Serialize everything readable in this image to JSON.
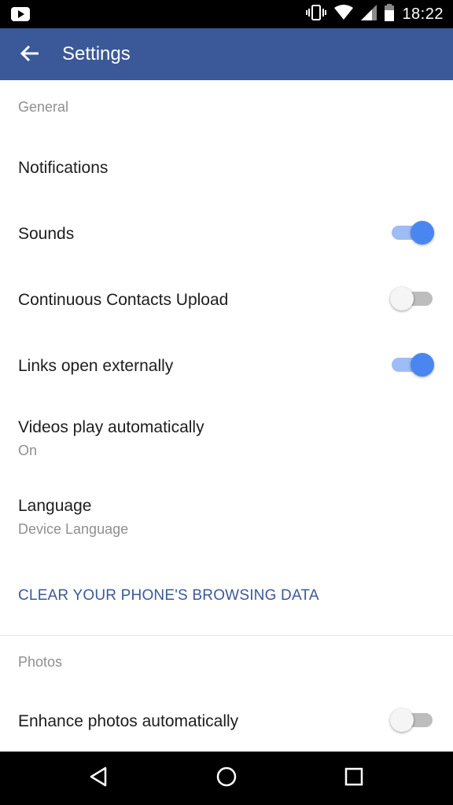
{
  "status_bar": {
    "time": "18:22",
    "left_icon": "youtube-notification-icon",
    "icons": [
      "vibrate-icon",
      "wifi-icon",
      "cell-signal-icon",
      "battery-icon"
    ]
  },
  "app_bar": {
    "title": "Settings",
    "back_icon": "back-arrow-icon",
    "color": "#3b5998"
  },
  "sections": {
    "general": {
      "header": "General",
      "notifications": {
        "title": "Notifications"
      },
      "sounds": {
        "title": "Sounds",
        "enabled": true
      },
      "contacts_upload": {
        "title": "Continuous Contacts Upload",
        "enabled": false
      },
      "links_external": {
        "title": "Links open externally",
        "enabled": true
      },
      "videos_autoplay": {
        "title": "Videos play automatically",
        "value": "On"
      },
      "language": {
        "title": "Language",
        "value": "Device Language"
      },
      "clear_data": {
        "label": "CLEAR YOUR PHONE'S BROWSING DATA"
      }
    },
    "photos": {
      "header": "Photos",
      "enhance": {
        "title": "Enhance photos automatically",
        "enabled": false
      }
    }
  },
  "nav_bar": {
    "icons": [
      "nav-back-icon",
      "nav-home-icon",
      "nav-recents-icon"
    ]
  },
  "colors": {
    "accent": "#4a86f0",
    "link": "#3b5998"
  }
}
